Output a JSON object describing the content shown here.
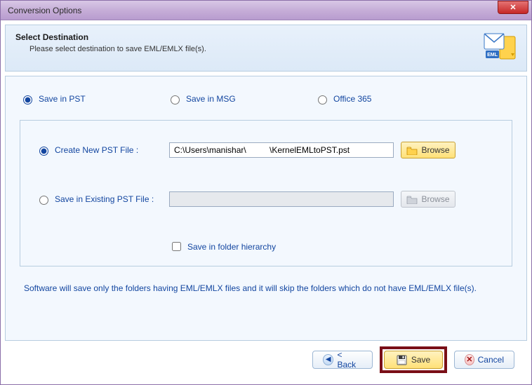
{
  "window": {
    "title": "Conversion Options"
  },
  "header": {
    "title": "Select Destination",
    "subtitle": "Please select destination to save EML/EMLX file(s)."
  },
  "options": {
    "pst": "Save in PST",
    "msg": "Save in MSG",
    "o365": "Office 365"
  },
  "pst_panel": {
    "create_label": "Create New PST File :",
    "create_path": "C:\\Users\\manishar\\          \\KernelEMLtoPST.pst",
    "existing_label": "Save in Existing PST File :",
    "existing_path": "",
    "browse_label": "Browse",
    "hierarchy_label": "Save in folder hierarchy"
  },
  "note": "Software will save only the folders having EML/EMLX files and it will skip the folders which do not have EML/EMLX file(s).",
  "buttons": {
    "back": "< Back",
    "save": "Save",
    "cancel": "Cancel"
  }
}
